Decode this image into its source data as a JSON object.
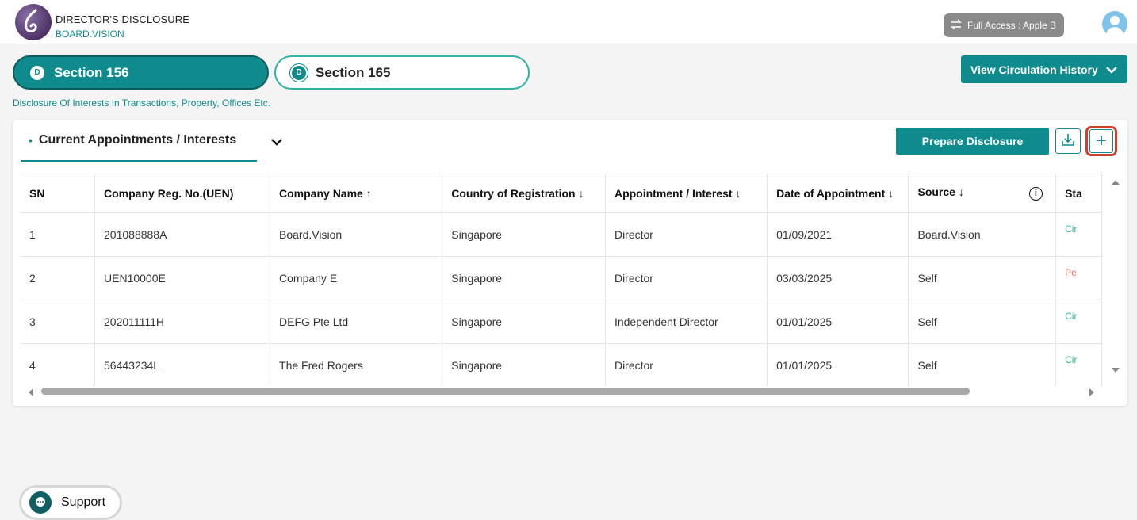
{
  "header": {
    "app_title": "DIRECTOR'S DISCLOSURE",
    "app_subtitle": "BOARD.VISION",
    "access_label": "Full Access : Apple B",
    "logo_icon": "board-vision-logo",
    "avatar_icon": "user-avatar-icon",
    "switch_icon": "swap-arrows-icon"
  },
  "sections": {
    "section_156_label": "Section 156",
    "section_165_label": "Section 165",
    "badge_letter": "D",
    "description": "Disclosure Of Interests In Transactions, Property, Offices Etc."
  },
  "toolbar": {
    "view_history_label": "View Circulation History",
    "prepare_label": "Prepare Disclosure",
    "add_symbol": "+"
  },
  "tab": {
    "bullet": "•",
    "label": "Current Appointments / Interests"
  },
  "table": {
    "columns": [
      "SN",
      "Company Reg. No.(UEN)",
      "Company Name ↑",
      "Country of Registration ↓",
      "Appointment / Interest ↓",
      "Date of Appointment ↓",
      "Source ↓",
      "Sta"
    ],
    "info_symbol": "i",
    "rows": [
      {
        "sn": "1",
        "uen": "201088888A",
        "name": "Board.Vision",
        "country": "Singapore",
        "appointment": "Director",
        "date": "01/09/2021",
        "source": "Board.Vision",
        "status": "Cir"
      },
      {
        "sn": "2",
        "uen": "UEN10000E",
        "name": "Company E",
        "country": "Singapore",
        "appointment": "Director",
        "date": "03/03/2025",
        "source": "Self",
        "status": "Pe"
      },
      {
        "sn": "3",
        "uen": "202011111H",
        "name": "DEFG Pte Ltd",
        "country": "Singapore",
        "appointment": "Independent Director",
        "date": "01/01/2025",
        "source": "Self",
        "status": "Cir"
      },
      {
        "sn": "4",
        "uen": "56443234L",
        "name": "The Fred Rogers",
        "country": "Singapore",
        "appointment": "Director",
        "date": "01/01/2025",
        "source": "Self",
        "status": "Cir"
      }
    ]
  },
  "support": {
    "label": "Support"
  },
  "colors": {
    "accent": "#0f8b8d",
    "status_green": "#2fbb98",
    "status_red": "#e8695f",
    "highlight": "#d0412b"
  }
}
